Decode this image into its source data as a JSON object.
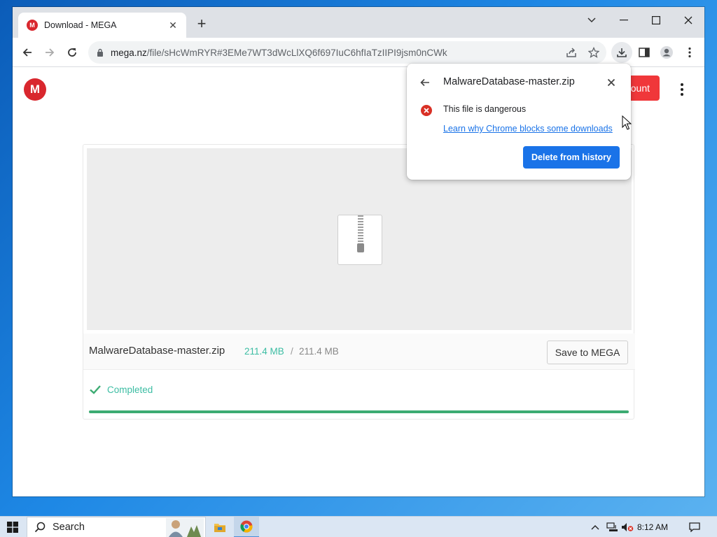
{
  "browser": {
    "tab_title": "Download - MEGA",
    "url_domain": "mega.nz",
    "url_path": "/file/sHcWmRYR#3EMe7WT3dWcLlXQ6f697IuC6hfIaTzIIPI9jsm0nCWk"
  },
  "page": {
    "logo_letter": "M",
    "header_button_partial": "ount",
    "file_name": "MalwareDatabase-master.zip",
    "size_downloaded": "211.4 MB",
    "size_separator": "/",
    "size_total": "211.4 MB",
    "save_button": "Save to MEGA",
    "status": "Completed",
    "progress_fraction": 1.0
  },
  "download_popup": {
    "title": "MalwareDatabase-master.zip",
    "danger_text": "This file is dangerous",
    "learn_link": "Learn why Chrome blocks some downloads",
    "delete_button": "Delete from history"
  },
  "taskbar": {
    "search_label": "Search",
    "time": "8:12 AM"
  },
  "colors": {
    "mega_red": "#d9272e",
    "accent_green": "#3cbda3",
    "progress_green": "#3cab72",
    "chrome_blue": "#1a73e8",
    "danger_red": "#d93025"
  }
}
